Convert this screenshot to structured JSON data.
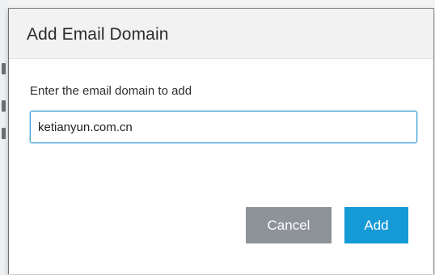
{
  "dialog": {
    "title": "Add Email Domain",
    "field_label": "Enter the email domain to add",
    "domain_input": {
      "value": "ketianyun.com.cn"
    },
    "buttons": {
      "cancel_label": "Cancel",
      "add_label": "Add"
    }
  },
  "colors": {
    "primary_button": "#169ad6",
    "secondary_button": "#8d9399",
    "input_focus_border": "#4aa4d9",
    "header_background": "#f2f2f2"
  }
}
